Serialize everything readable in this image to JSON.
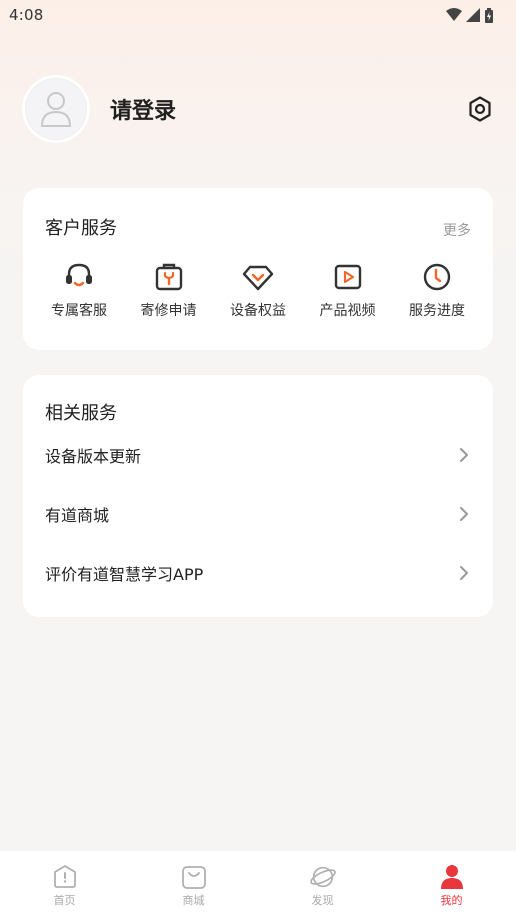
{
  "status_bar": {
    "time": "4:08"
  },
  "profile": {
    "login_text": "请登录"
  },
  "customer_service": {
    "title": "客户服务",
    "more": "更多",
    "items": [
      {
        "label": "专属客服",
        "icon": "headset-icon"
      },
      {
        "label": "寄修申请",
        "icon": "repair-box-icon"
      },
      {
        "label": "设备权益",
        "icon": "diamond-icon"
      },
      {
        "label": "产品视频",
        "icon": "video-icon"
      },
      {
        "label": "服务进度",
        "icon": "clock-icon"
      }
    ]
  },
  "related_services": {
    "title": "相关服务",
    "items": [
      {
        "label": "设备版本更新"
      },
      {
        "label": "有道商城"
      },
      {
        "label": "评价有道智慧学习APP"
      }
    ]
  },
  "bottom_nav": {
    "items": [
      {
        "label": "首页",
        "icon": "home-icon"
      },
      {
        "label": "商城",
        "icon": "shopping-bag-icon"
      },
      {
        "label": "发现",
        "icon": "planet-icon"
      },
      {
        "label": "我的",
        "icon": "person-icon",
        "active": true
      }
    ]
  },
  "colors": {
    "accent": "#e8383d",
    "icon_orange": "#f0672a",
    "icon_dark": "#333333"
  }
}
